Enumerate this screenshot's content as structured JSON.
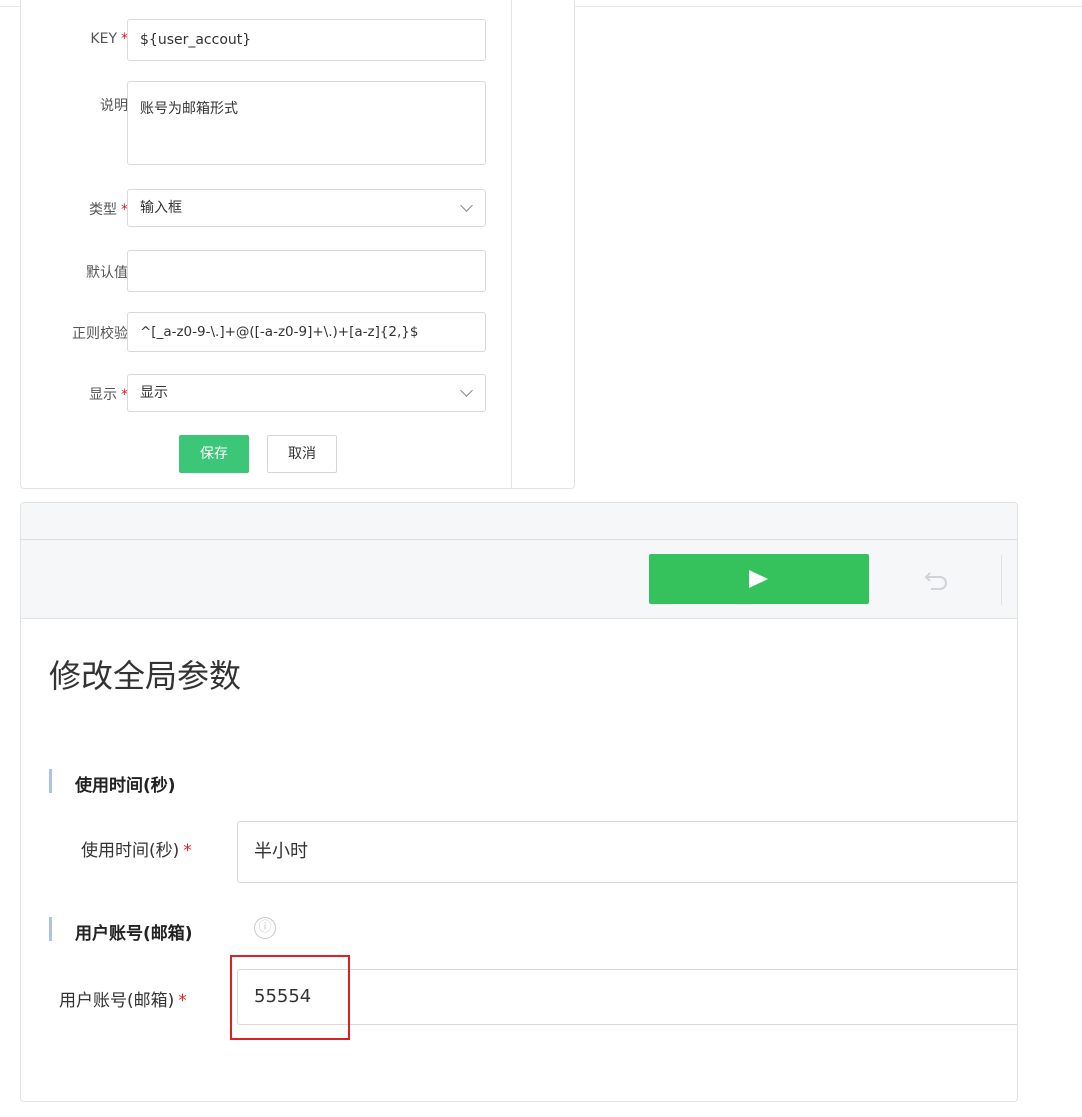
{
  "form": {
    "key": {
      "label": "KEY",
      "required": "*",
      "value": "${user_accout}"
    },
    "description": {
      "label": "说明",
      "value": "账号为邮箱形式"
    },
    "type": {
      "label": "类型",
      "required": "*",
      "value": "输入框"
    },
    "default": {
      "label": "默认值",
      "value": ""
    },
    "regex": {
      "label": "正则校验",
      "value": "^[_a-z0-9-\\.]+@([-a-z0-9]+\\.)+[a-z]{2,}$"
    },
    "display": {
      "label": "显示",
      "required": "*",
      "value": "显示"
    },
    "save_label": "保存",
    "cancel_label": "取消"
  },
  "card": {
    "toolbar": {
      "run_icon": "play-icon",
      "undo_icon": "undo-icon"
    },
    "title": "修改全局参数",
    "sections": [
      {
        "title": "使用时间(秒)",
        "field_label": "使用时间(秒)",
        "required": "*",
        "value": "半小时"
      },
      {
        "title": "用户账号(邮箱)",
        "info_icon": "ⓘ",
        "field_label": "用户账号(邮箱)",
        "required": "*",
        "value": "55554"
      }
    ]
  },
  "colors": {
    "primary_green": "#3cc677",
    "run_green": "#35c25c",
    "required_red": "#e02020",
    "highlight_red": "#e02020"
  }
}
